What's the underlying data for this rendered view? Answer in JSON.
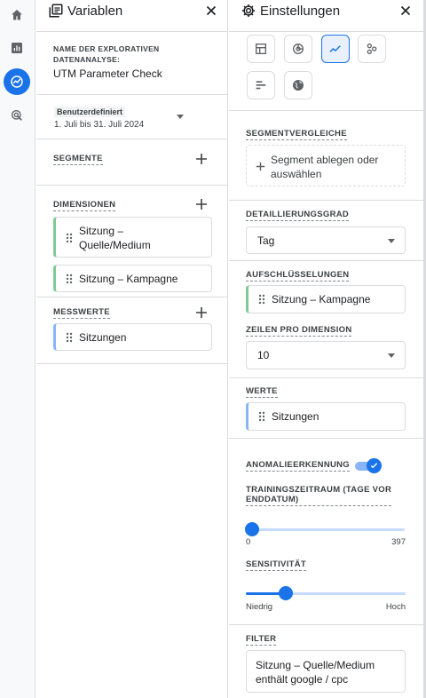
{
  "variables": {
    "title": "Variablen",
    "name_caption_line1": "NAME DER EXPLORATIVEN",
    "name_caption_line2": "DATENANALYSE:",
    "exploration_name": "UTM Parameter Check",
    "date_badge": "Benutzerdefiniert",
    "date_range": "1. Juli bis 31. Juli 2024",
    "segments_caption": "SEGMENTE",
    "dimensions_caption": "DIMENSIONEN",
    "dimensions": [
      {
        "line1": "Sitzung –",
        "line2": "Quelle/Medium"
      },
      {
        "line1": "Sitzung – Kampagne"
      }
    ],
    "metrics_caption": "MESSWERTE",
    "metrics": [
      {
        "label": "Sitzungen"
      }
    ]
  },
  "settings": {
    "title": "Einstellungen",
    "viz_types": [
      "table-icon",
      "donut-chart-icon",
      "line-chart-icon",
      "scatter-icon",
      "bar-chart-icon",
      "globe-icon"
    ],
    "selected_viz": "line-chart-icon",
    "segment_compare_caption": "SEGMENTVERGLEICHE",
    "segment_drop_line1": "Segment ablegen oder",
    "segment_drop_line2": "auswählen",
    "granularity_caption": "DETAILLIERUNGSGRAD",
    "granularity_value": "Tag",
    "breakdowns_caption": "AUFSCHLÜSSELUNGEN",
    "breakdown_value": "Sitzung – Kampagne",
    "rows_caption": "ZEILEN PRO DIMENSION",
    "rows_value": "10",
    "values_caption": "WERTE",
    "values_value": "Sitzungen",
    "anomaly_caption": "ANOMALIEERKENNUNG",
    "anomaly_enabled": true,
    "training_caption_line1": "TRAININGSZEITRAUM (TAGE VOR",
    "training_caption_line2": "ENDDATUM)",
    "training_min": "0",
    "training_max": "397",
    "training_value_fraction": 0.0,
    "sensitivity_caption": "SENSITIVITÄT",
    "sensitivity_low": "Niedrig",
    "sensitivity_high": "Hoch",
    "sensitivity_value_fraction": 0.25,
    "filter_caption": "FILTER",
    "filter_line1": "Sitzung – Quelle/Medium",
    "filter_line2": "enthält google / cpc"
  },
  "colors": {
    "accent": "#1a73e8",
    "dimension": "#81c995",
    "metric": "#8ab4f8"
  }
}
